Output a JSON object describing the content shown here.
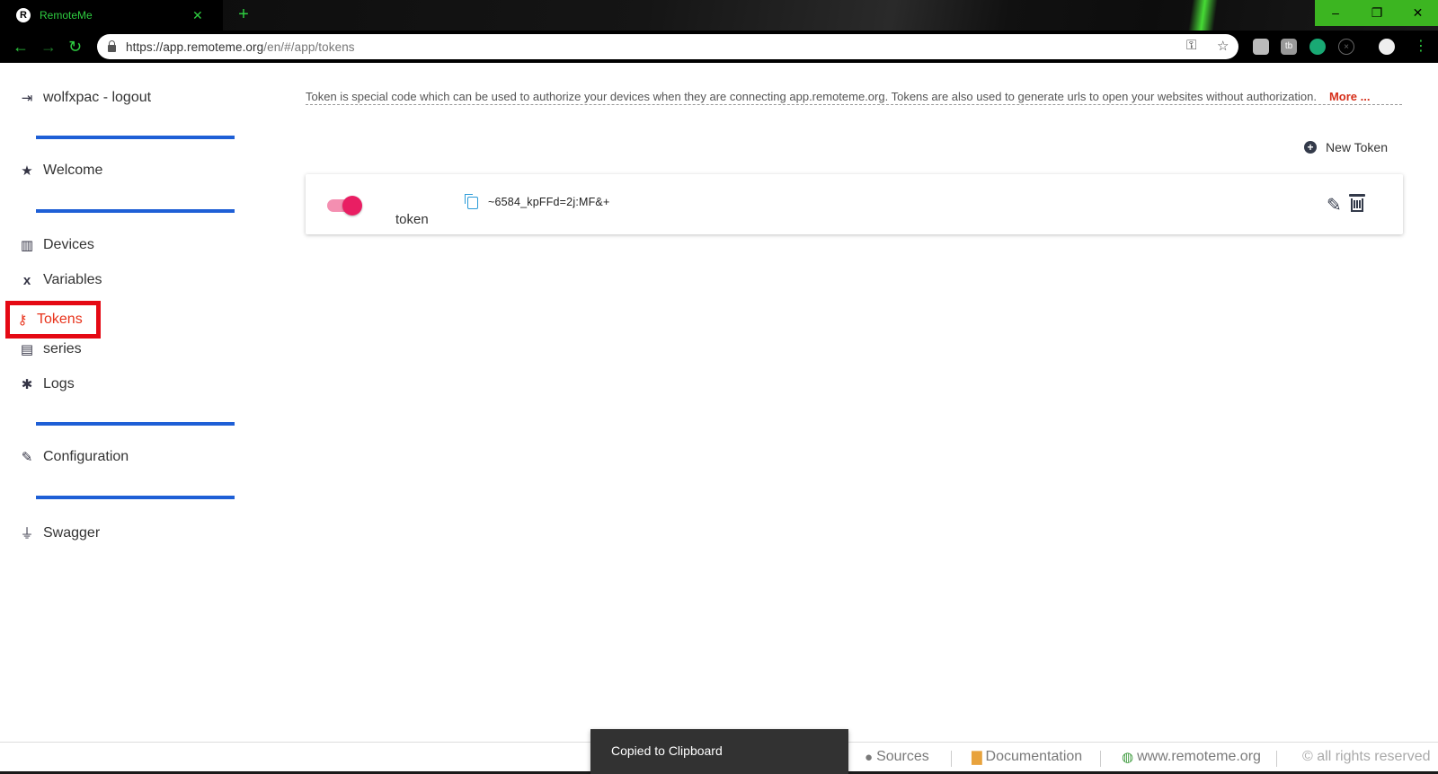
{
  "browser": {
    "tab_title": "RemoteMe",
    "favicon_letter": "R",
    "tab_close": "✕",
    "new_tab": "+",
    "url_main": "https://app.remoteme.org",
    "url_path": "/en/#/app/tokens",
    "window_buttons": {
      "minimize": "–",
      "restore": "❐",
      "close": "✕"
    }
  },
  "sidebar": {
    "user_item": "wolfxpac - logout",
    "welcome": "Welcome",
    "devices": "Devices",
    "variables": "Variables",
    "tokens": "Tokens",
    "series": "series",
    "logs": "Logs",
    "configuration": "Configuration",
    "swagger": "Swagger"
  },
  "main": {
    "info_text": "Token is special code which can be used to authorize your devices when they are connecting app.remoteme.org. Tokens are also used to generate urls to open your websites without authorization.",
    "info_more": "More ...",
    "new_token_label": "New Token",
    "tokens": [
      {
        "name": "token",
        "value": "~6584_kpFFd=2j:MF&+",
        "enabled": true
      }
    ]
  },
  "footer": {
    "sources": "Sources",
    "documentation": "Documentation",
    "website": "www.remoteme.org",
    "rights": "© all rights reserved"
  },
  "toast": {
    "message": "Copied to Clipboard"
  },
  "colors": {
    "accent_blue": "#1e5fd6",
    "active_red": "#e8331b",
    "toggle_pink": "#e91e63",
    "browser_green": "#2ecc40"
  }
}
